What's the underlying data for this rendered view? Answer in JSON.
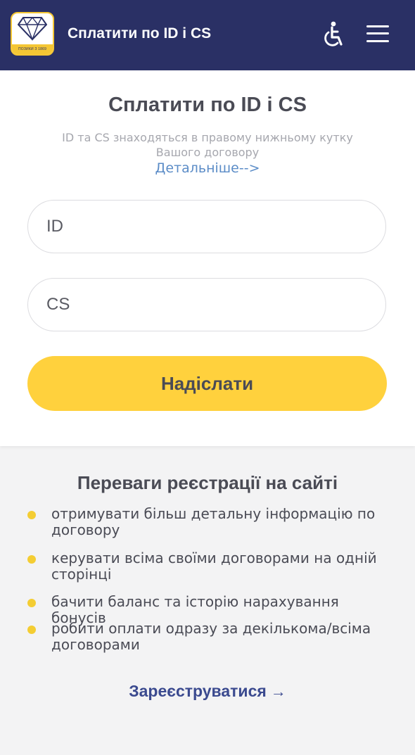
{
  "header": {
    "logo_text": "ПОЗИКИ З 1869",
    "title": "Сплатити по ID і CS",
    "accessibility_icon": "wheelchair-icon",
    "menu_icon": "hamburger-menu-icon"
  },
  "form": {
    "title": "Сплатити по ID і CS",
    "hint": "ID та CS знаходяться в правому нижньому кутку Вашого договору",
    "details_link": "Детальніше-->",
    "id_placeholder": "ID",
    "cs_placeholder": "CS",
    "submit_label": "Надіслати"
  },
  "benefits": {
    "title": "Переваги реєстрації на сайті",
    "items": [
      "отримувати більш детальну інформацію по договору",
      "керувати всіма своїми договорами на одній сторінці",
      "бачити баланс та історію нарахування бонусів",
      "робити оплати одразу за декількома/всіма договорами"
    ],
    "register_label": "Зареєструватися",
    "register_arrow": "→"
  },
  "colors": {
    "header_bg": "#2a3065",
    "accent_yellow": "#ffd13d",
    "link_blue": "#5b8cc7",
    "register_blue": "#3b4a8f"
  }
}
